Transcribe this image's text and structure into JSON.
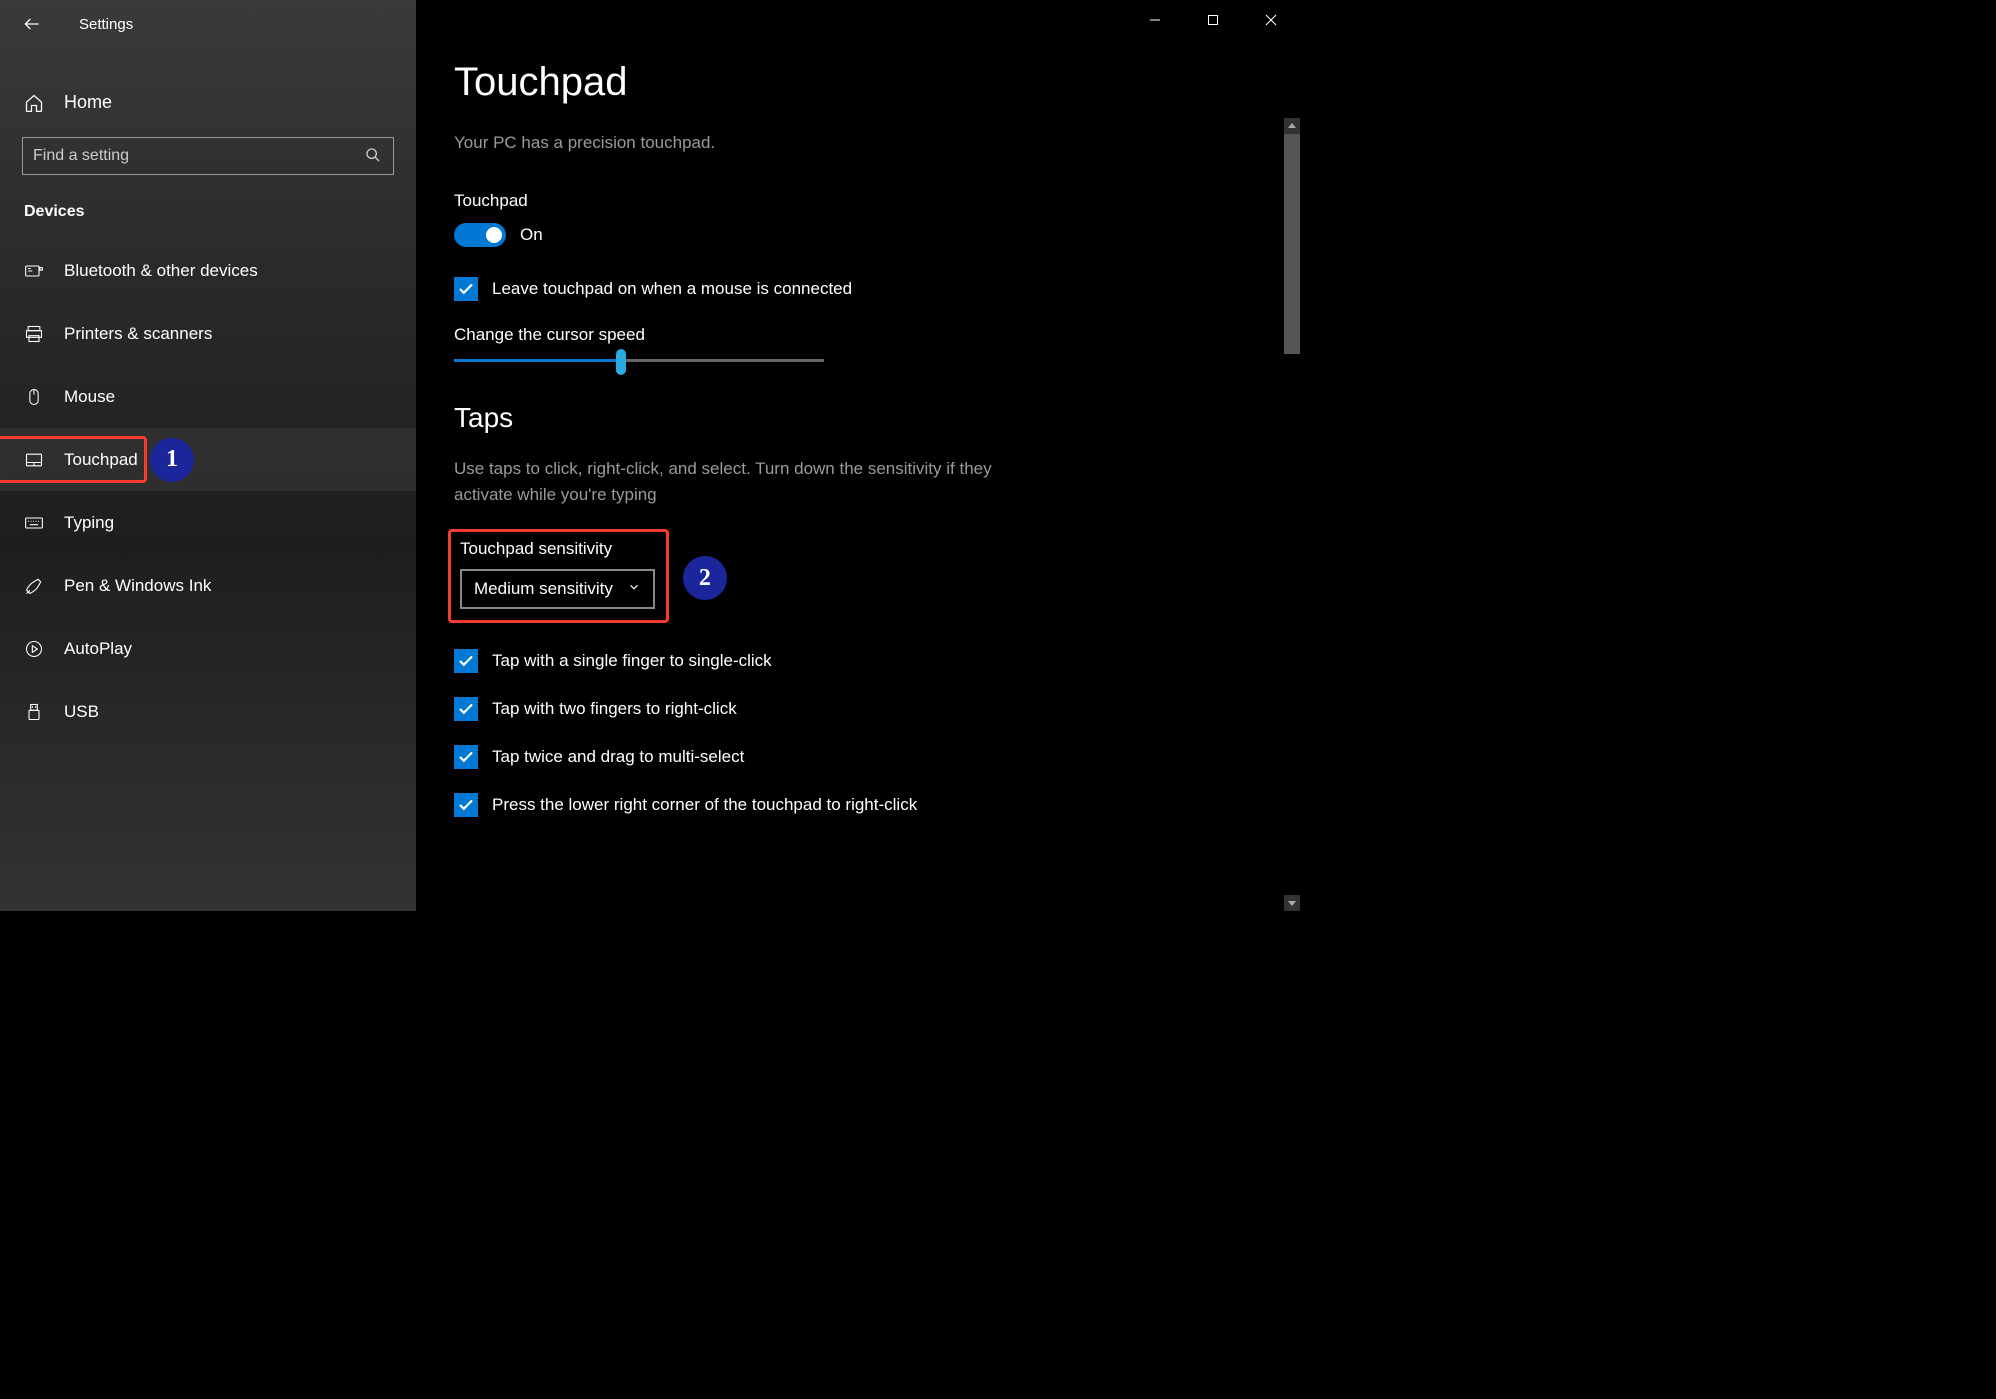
{
  "app_title": "Settings",
  "home_label": "Home",
  "search_placeholder": "Find a setting",
  "sidebar_section": "Devices",
  "nav_items": [
    {
      "label": "Bluetooth & other devices"
    },
    {
      "label": "Printers & scanners"
    },
    {
      "label": "Mouse"
    },
    {
      "label": "Touchpad"
    },
    {
      "label": "Typing"
    },
    {
      "label": "Pen & Windows Ink"
    },
    {
      "label": "AutoPlay"
    },
    {
      "label": "USB"
    }
  ],
  "page": {
    "title": "Touchpad",
    "subtitle": "Your PC has a precision touchpad.",
    "toggle_label": "Touchpad",
    "toggle_state": "On",
    "leave_on_label": "Leave touchpad on when a mouse is connected",
    "cursor_speed_label": "Change the cursor speed",
    "cursor_speed_percent": 45,
    "taps_heading": "Taps",
    "taps_desc": "Use taps to click, right-click, and select. Turn down the sensitivity if they activate while you're typing",
    "sensitivity_label": "Touchpad sensitivity",
    "sensitivity_value": "Medium sensitivity",
    "tap_options": [
      "Tap with a single finger to single-click",
      "Tap with two fingers to right-click",
      "Tap twice and drag to multi-select",
      "Press the lower right corner of the touchpad to right-click"
    ]
  },
  "annotations": {
    "badge1": "1",
    "badge2": "2"
  },
  "colors": {
    "accent": "#0078d4",
    "highlight": "#f33b2f",
    "badge_bg": "#1b269b"
  }
}
